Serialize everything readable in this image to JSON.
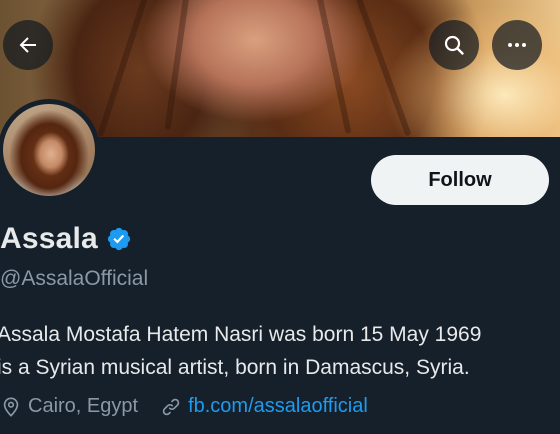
{
  "header": {
    "back_icon": "arrow-left-icon",
    "search_icon": "search-icon",
    "more_icon": "more-horizontal-icon"
  },
  "profile": {
    "name": "Assala",
    "verified": true,
    "verified_color": "#1d9bf0",
    "handle": "@AssalaOfficial",
    "follow_label": "Follow",
    "bio_lines": [
      "Assala Mostafa Hatem Nasri was born 15 May 1969",
      "is a Syrian musical artist, born in Damascus, Syria."
    ],
    "location": "Cairo, Egypt",
    "website": "fb.com/assalaofficial"
  },
  "colors": {
    "background": "#15202b",
    "text_primary": "#e7e9ea",
    "text_secondary": "#8b98a5",
    "accent": "#1d9bf0",
    "follow_bg": "#eff3f4"
  }
}
